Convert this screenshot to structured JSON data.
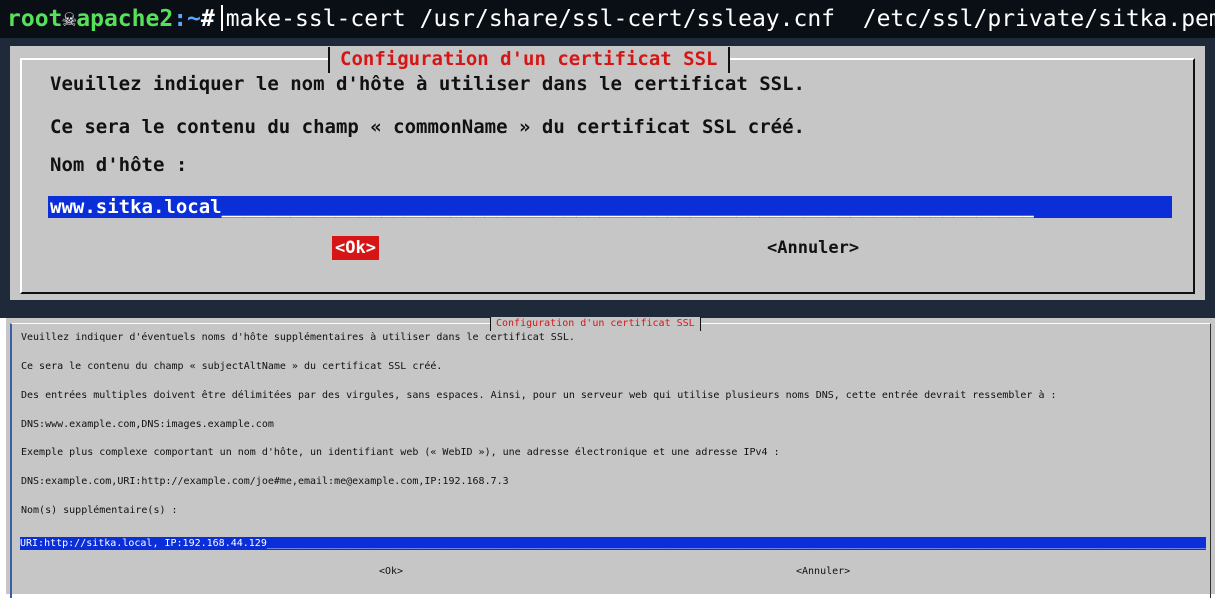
{
  "terminal": {
    "user": "root",
    "host": "apache2",
    "path": ":~",
    "prompt_char": "#",
    "command": "make-ssl-cert /usr/share/ssl-cert/ssleay.cnf  /etc/ssl/private/sitka.pem",
    "icon": "skull-icon"
  },
  "dialog_top": {
    "title": "Configuration d'un certificat SSL",
    "line1": "Veuillez indiquer le nom d'hôte à utiliser dans le certificat SSL.",
    "line2": "Ce sera le contenu du champ « commonName » du certificat SSL créé.",
    "label": "Nom d'hôte :",
    "input_value": "www.sitka.local",
    "input_fill": "_______________________________________________________________________",
    "ok": "<Ok>",
    "cancel": "<Annuler>"
  },
  "dialog_bottom": {
    "title": "Configuration d'un certificat SSL",
    "line1": "Veuillez indiquer d'éventuels noms d'hôte supplémentaires à utiliser dans le certificat SSL.",
    "line2": "Ce sera le contenu du champ « subjectAltName » du certificat SSL créé.",
    "line3": "Des entrées multiples doivent être délimitées par des virgules, sans espaces. Ainsi, pour un serveur web qui utilise plusieurs noms DNS, cette entrée devrait ressembler à :",
    "line4": "DNS:www.example.com,DNS:images.example.com",
    "line5": "Exemple plus complexe comportant un nom d'hôte, un identifiant web (« WebID »), une adresse électronique et une adresse IPv4 :",
    "line6": "DNS:example.com,URI:http://example.com/joe#me,email:me@example.com,IP:192.168.7.3",
    "label": "Nom(s) supplémentaire(s) :",
    "input_value": "URI:http://sitka.local, IP:192.168.44.129",
    "input_fill": "____________________________________________________________________________________________________________________________________________________________________________________",
    "ok": "<Ok>",
    "cancel": "<Annuler>"
  },
  "colors": {
    "terminal_bg": "#1e2a3a",
    "dialog_bg": "#c6c6c6",
    "title_red": "#d61616",
    "input_blue": "#0a2ed8",
    "prompt_green": "#56e15b",
    "path_blue": "#5aa7ff"
  }
}
